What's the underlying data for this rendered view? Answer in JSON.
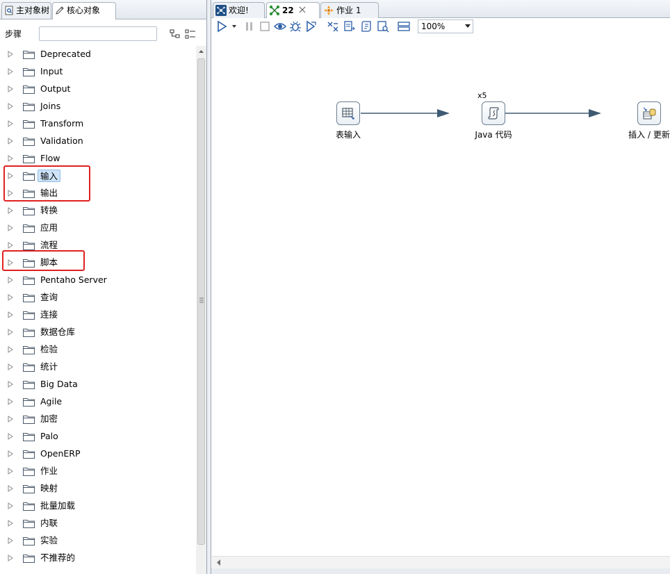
{
  "left_tabs": {
    "main_tree": "主对象树",
    "core_objects": "核心对象"
  },
  "steps_panel": {
    "label": "步骤",
    "search_value": "",
    "search_placeholder": ""
  },
  "tree": {
    "items": [
      {
        "label": "Deprecated"
      },
      {
        "label": "Input"
      },
      {
        "label": "Output"
      },
      {
        "label": "Joins"
      },
      {
        "label": "Transform"
      },
      {
        "label": "Validation"
      },
      {
        "label": "Flow"
      },
      {
        "label": "输入",
        "selected": true
      },
      {
        "label": "输出"
      },
      {
        "label": "转换"
      },
      {
        "label": "应用"
      },
      {
        "label": "流程"
      },
      {
        "label": "脚本"
      },
      {
        "label": "Pentaho Server"
      },
      {
        "label": "查询"
      },
      {
        "label": "连接"
      },
      {
        "label": "数据仓库"
      },
      {
        "label": "检验"
      },
      {
        "label": "统计"
      },
      {
        "label": "Big Data"
      },
      {
        "label": "Agile"
      },
      {
        "label": "加密"
      },
      {
        "label": "Palo"
      },
      {
        "label": "OpenERP"
      },
      {
        "label": "作业"
      },
      {
        "label": "映射"
      },
      {
        "label": "批量加载"
      },
      {
        "label": "内联"
      },
      {
        "label": "实验"
      },
      {
        "label": "不推荐的"
      }
    ]
  },
  "editor_tabs": {
    "welcome": "欢迎!",
    "transformation": "22",
    "job": "作业 1"
  },
  "toolbar": {
    "zoom": "100%"
  },
  "canvas": {
    "steps": [
      {
        "label": "表输入",
        "icon": "table-input-icon"
      },
      {
        "label": "Java 代码",
        "icon": "java-code-icon",
        "copies": "x5"
      },
      {
        "label": "插入 / 更新",
        "icon": "insert-update-icon"
      }
    ]
  },
  "colors": {
    "highlight_box": "#e02020",
    "selection": "#cfe4f9",
    "hop_line": "#3f5a73"
  }
}
